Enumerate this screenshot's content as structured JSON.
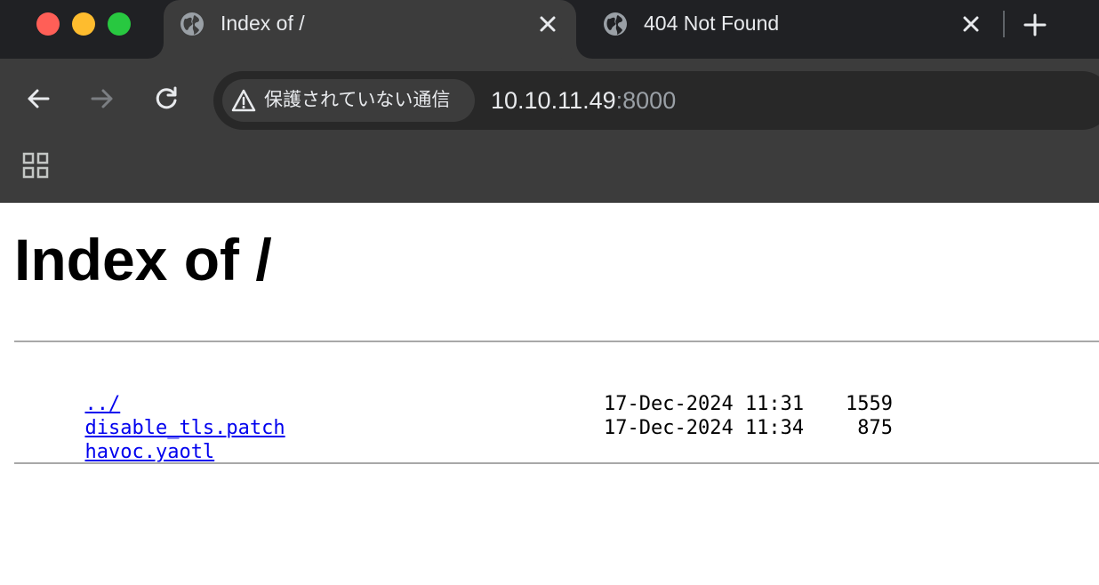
{
  "tabs": [
    {
      "title": "Index of /",
      "active": true,
      "icon": "globe-icon"
    },
    {
      "title": "404 Not Found",
      "active": false,
      "icon": "globe-icon"
    }
  ],
  "omnibox": {
    "security_label": "保護されていない通信",
    "url_host": "10.10.11.49",
    "url_port": ":8000"
  },
  "page": {
    "heading": "Index of /",
    "entries": [
      {
        "name": "../",
        "date": "",
        "size": ""
      },
      {
        "name": "disable_tls.patch",
        "date": "17-Dec-2024 11:31",
        "size": "1559"
      },
      {
        "name": "havoc.yaotl",
        "date": "17-Dec-2024 11:34",
        "size": "875"
      }
    ]
  },
  "colors": {
    "tabstrip": "#202124",
    "toolbar": "#3c3c3c",
    "link": "#0000ee"
  }
}
